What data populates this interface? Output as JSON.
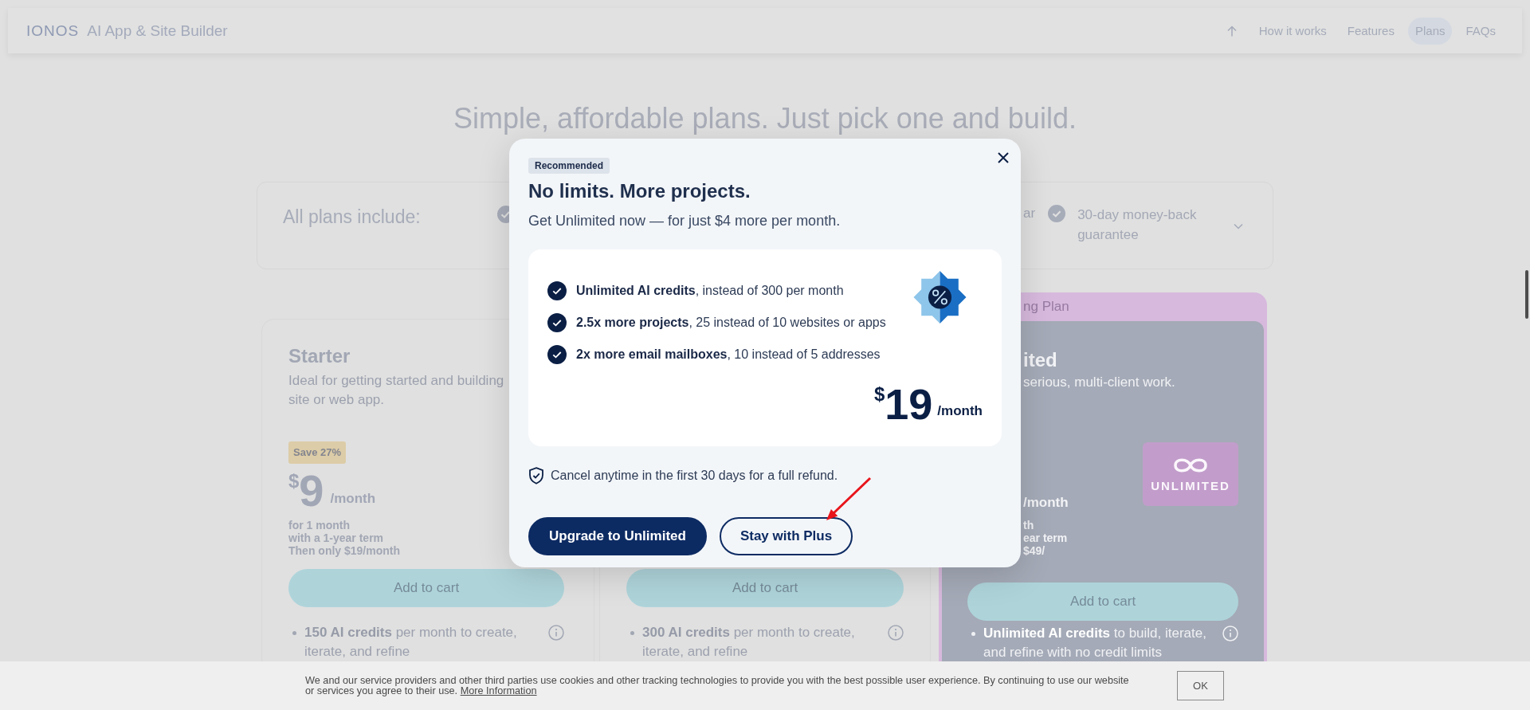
{
  "header": {
    "logo": "IONOS",
    "product": "AI App & Site Builder",
    "nav": [
      {
        "label": "How it works",
        "selected": false
      },
      {
        "label": "Features",
        "selected": false
      },
      {
        "label": "Plans",
        "selected": true
      },
      {
        "label": "FAQs",
        "selected": false
      }
    ]
  },
  "heading": "Simple, affordable plans. Just pick one and build.",
  "plans_include": {
    "label": "All plans include:",
    "expanded": false,
    "items": [
      {
        "kind": "icon_only"
      },
      {
        "kind": "text_only",
        "text": "ar"
      },
      {
        "kind": "full",
        "text": "30-day money-back guarantee"
      }
    ]
  },
  "plans": [
    {
      "kind": "standard",
      "name": "Starter",
      "description_lines": [
        "Ideal for getting started and building",
        "site or web app."
      ],
      "badge": "Save 27%",
      "price": {
        "currency": "$",
        "amount": "9",
        "period": "/month"
      },
      "terms": [
        "for 1 month",
        "with a 1-year term",
        "Then only $19/month"
      ],
      "button": "Add to cart",
      "features": [
        "**150 AI credits** per month to create, iterate, and refine"
      ]
    },
    {
      "kind": "covered",
      "button": "Add to cart",
      "features": [
        "**300 AI credits** per month to create, iterate, and refine"
      ]
    },
    {
      "kind": "featured",
      "banner": "ng Plan",
      "name": "ited",
      "description": "serious, multi-client work.",
      "logo": "UNLIMITED",
      "price": {
        "period": "/month"
      },
      "terms": [
        "th",
        "ear term",
        "$49/"
      ],
      "button": "Add to cart",
      "features": [
        "**Unlimited AI credits** to build, iterate, and refine with no credit limits"
      ]
    }
  ],
  "dialog": {
    "badge": "Recommended",
    "title": "No limits. More projects.",
    "subtitle": "Get Unlimited now — for just $4 more per month.",
    "benefits": [
      "**Unlimited AI credits**, instead of 300 per month",
      "**2.5x more projects**, 25 instead of 10 websites or apps",
      "**2x more email mailboxes**, 10 instead of 5 addresses"
    ],
    "price": {
      "currency": "$",
      "amount": "19",
      "period": "/month"
    },
    "guarantee": "Cancel anytime in the first 30 days for a full refund.",
    "buttons": [
      {
        "kind": "primary",
        "label": "Upgrade to Unlimited"
      },
      {
        "kind": "secondary",
        "label": "Stay with Plus"
      }
    ]
  },
  "cookie_banner": {
    "text": "We and our service providers and other third parties use cookies and other tracking technologies to provide you with the best possible user experience. By continuing to use our website or services you agree to their use.",
    "link": "More Information",
    "button": "OK"
  }
}
